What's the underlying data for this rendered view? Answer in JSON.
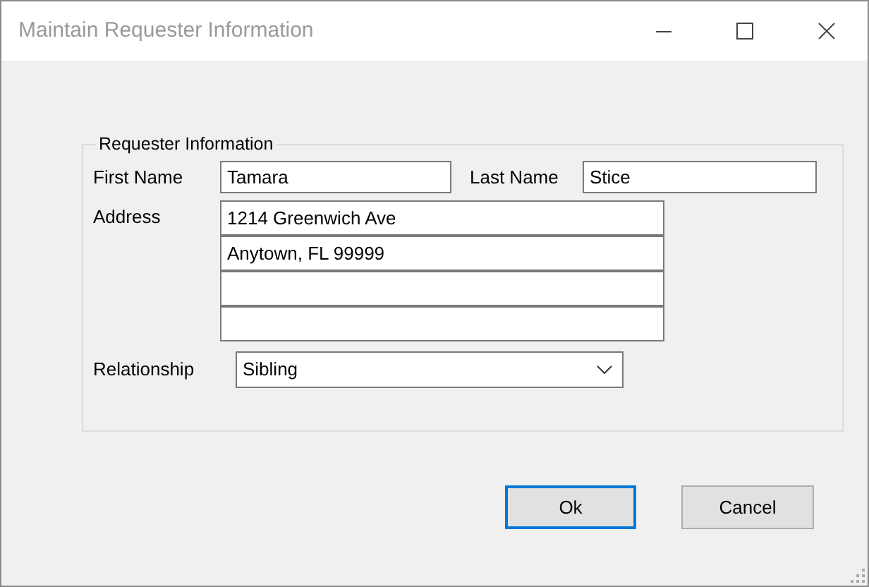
{
  "window": {
    "title": "Maintain Requester Information"
  },
  "group": {
    "title": "Requester Information"
  },
  "first_name": {
    "label": "First Name",
    "value": "Tamara"
  },
  "last_name": {
    "label": "Last Name",
    "value": "Stice"
  },
  "address": {
    "label": "Address",
    "lines": [
      {
        "kind": "filled",
        "value": "1214 Greenwich Ave"
      },
      {
        "kind": "filled",
        "value": "Anytown, FL 99999"
      },
      {
        "kind": "blank"
      },
      {
        "kind": "blank"
      }
    ]
  },
  "relationship": {
    "label": "Relationship",
    "value": "Sibling"
  },
  "buttons": [
    {
      "label": "Ok",
      "default": true
    },
    {
      "label": "Cancel",
      "default": false
    }
  ]
}
